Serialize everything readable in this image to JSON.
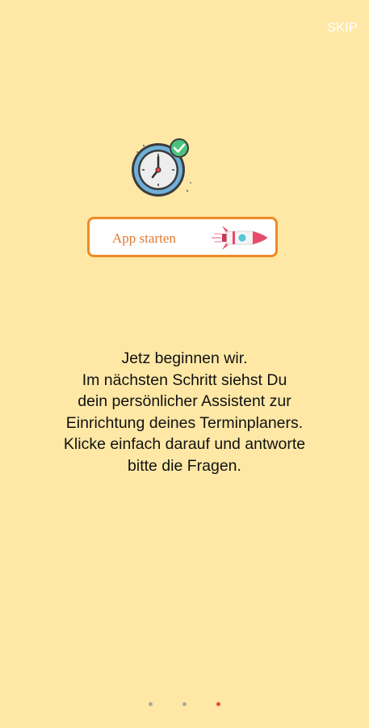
{
  "header": {
    "skip_label": "SKIP"
  },
  "app_card": {
    "label": "App starten"
  },
  "message": {
    "lines": [
      "Jetz beginnen wir.",
      "Im nächsten Schritt siehst Du",
      "dein persönlicher Assistent zur",
      "Einrichtung deines Terminplaners.",
      "Klicke einfach darauf und antworte",
      "bitte die Fragen."
    ]
  },
  "pagination": {
    "page_count": 3,
    "active_index": 2
  },
  "colors": {
    "background": "#FFE8A6",
    "accent": "#F08A24",
    "dot_inactive": "#A9A9A9",
    "dot_active": "#E84545"
  }
}
